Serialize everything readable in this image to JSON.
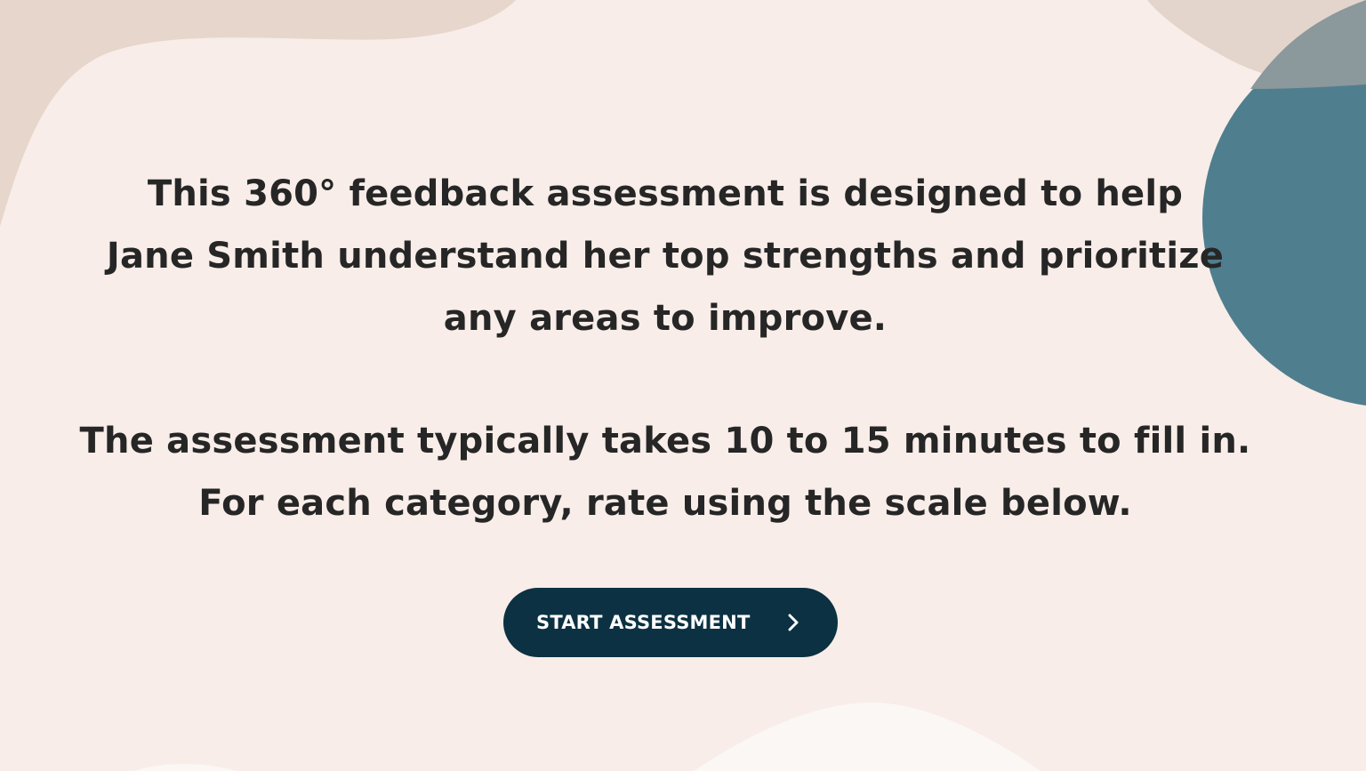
{
  "intro": {
    "line_1": "This 360° feedback assessment is designed to help",
    "line_2": "Jane Smith understand her top strengths and prioritize",
    "line_3": "any areas to improve."
  },
  "instructions": {
    "line_1": "The assessment typically takes 10 to 15 minutes to fill in.",
    "line_2": "For each category, rate using the scale below."
  },
  "cta": {
    "label": "START ASSESSMENT",
    "icon": "chevron-right-icon"
  },
  "colors": {
    "background": "#f8ede8",
    "button": "#0b3142",
    "accent_teal": "#4f7e8f",
    "accent_beige": "#e6d6cb"
  }
}
